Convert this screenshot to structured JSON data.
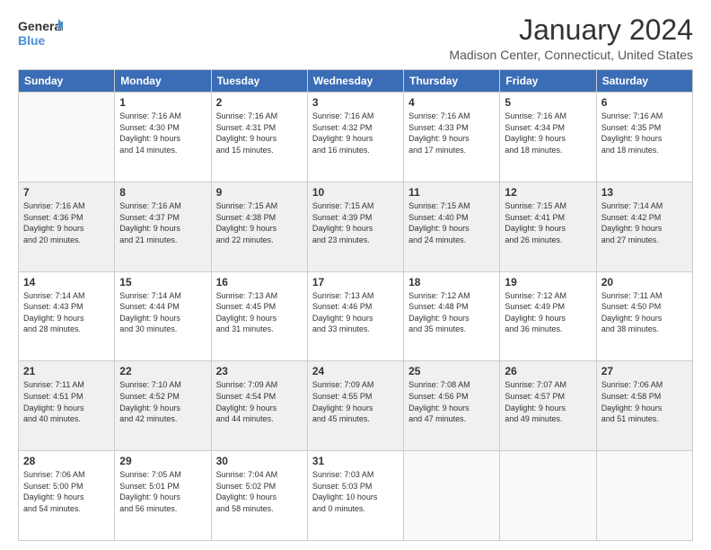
{
  "header": {
    "logo_line1": "General",
    "logo_line2": "Blue",
    "title": "January 2024",
    "subtitle": "Madison Center, Connecticut, United States"
  },
  "weekdays": [
    "Sunday",
    "Monday",
    "Tuesday",
    "Wednesday",
    "Thursday",
    "Friday",
    "Saturday"
  ],
  "weeks": [
    [
      {
        "day": "",
        "info": ""
      },
      {
        "day": "1",
        "info": "Sunrise: 7:16 AM\nSunset: 4:30 PM\nDaylight: 9 hours\nand 14 minutes."
      },
      {
        "day": "2",
        "info": "Sunrise: 7:16 AM\nSunset: 4:31 PM\nDaylight: 9 hours\nand 15 minutes."
      },
      {
        "day": "3",
        "info": "Sunrise: 7:16 AM\nSunset: 4:32 PM\nDaylight: 9 hours\nand 16 minutes."
      },
      {
        "day": "4",
        "info": "Sunrise: 7:16 AM\nSunset: 4:33 PM\nDaylight: 9 hours\nand 17 minutes."
      },
      {
        "day": "5",
        "info": "Sunrise: 7:16 AM\nSunset: 4:34 PM\nDaylight: 9 hours\nand 18 minutes."
      },
      {
        "day": "6",
        "info": "Sunrise: 7:16 AM\nSunset: 4:35 PM\nDaylight: 9 hours\nand 18 minutes."
      }
    ],
    [
      {
        "day": "7",
        "info": "Sunrise: 7:16 AM\nSunset: 4:36 PM\nDaylight: 9 hours\nand 20 minutes."
      },
      {
        "day": "8",
        "info": "Sunrise: 7:16 AM\nSunset: 4:37 PM\nDaylight: 9 hours\nand 21 minutes."
      },
      {
        "day": "9",
        "info": "Sunrise: 7:15 AM\nSunset: 4:38 PM\nDaylight: 9 hours\nand 22 minutes."
      },
      {
        "day": "10",
        "info": "Sunrise: 7:15 AM\nSunset: 4:39 PM\nDaylight: 9 hours\nand 23 minutes."
      },
      {
        "day": "11",
        "info": "Sunrise: 7:15 AM\nSunset: 4:40 PM\nDaylight: 9 hours\nand 24 minutes."
      },
      {
        "day": "12",
        "info": "Sunrise: 7:15 AM\nSunset: 4:41 PM\nDaylight: 9 hours\nand 26 minutes."
      },
      {
        "day": "13",
        "info": "Sunrise: 7:14 AM\nSunset: 4:42 PM\nDaylight: 9 hours\nand 27 minutes."
      }
    ],
    [
      {
        "day": "14",
        "info": "Sunrise: 7:14 AM\nSunset: 4:43 PM\nDaylight: 9 hours\nand 28 minutes."
      },
      {
        "day": "15",
        "info": "Sunrise: 7:14 AM\nSunset: 4:44 PM\nDaylight: 9 hours\nand 30 minutes."
      },
      {
        "day": "16",
        "info": "Sunrise: 7:13 AM\nSunset: 4:45 PM\nDaylight: 9 hours\nand 31 minutes."
      },
      {
        "day": "17",
        "info": "Sunrise: 7:13 AM\nSunset: 4:46 PM\nDaylight: 9 hours\nand 33 minutes."
      },
      {
        "day": "18",
        "info": "Sunrise: 7:12 AM\nSunset: 4:48 PM\nDaylight: 9 hours\nand 35 minutes."
      },
      {
        "day": "19",
        "info": "Sunrise: 7:12 AM\nSunset: 4:49 PM\nDaylight: 9 hours\nand 36 minutes."
      },
      {
        "day": "20",
        "info": "Sunrise: 7:11 AM\nSunset: 4:50 PM\nDaylight: 9 hours\nand 38 minutes."
      }
    ],
    [
      {
        "day": "21",
        "info": "Sunrise: 7:11 AM\nSunset: 4:51 PM\nDaylight: 9 hours\nand 40 minutes."
      },
      {
        "day": "22",
        "info": "Sunrise: 7:10 AM\nSunset: 4:52 PM\nDaylight: 9 hours\nand 42 minutes."
      },
      {
        "day": "23",
        "info": "Sunrise: 7:09 AM\nSunset: 4:54 PM\nDaylight: 9 hours\nand 44 minutes."
      },
      {
        "day": "24",
        "info": "Sunrise: 7:09 AM\nSunset: 4:55 PM\nDaylight: 9 hours\nand 45 minutes."
      },
      {
        "day": "25",
        "info": "Sunrise: 7:08 AM\nSunset: 4:56 PM\nDaylight: 9 hours\nand 47 minutes."
      },
      {
        "day": "26",
        "info": "Sunrise: 7:07 AM\nSunset: 4:57 PM\nDaylight: 9 hours\nand 49 minutes."
      },
      {
        "day": "27",
        "info": "Sunrise: 7:06 AM\nSunset: 4:58 PM\nDaylight: 9 hours\nand 51 minutes."
      }
    ],
    [
      {
        "day": "28",
        "info": "Sunrise: 7:06 AM\nSunset: 5:00 PM\nDaylight: 9 hours\nand 54 minutes."
      },
      {
        "day": "29",
        "info": "Sunrise: 7:05 AM\nSunset: 5:01 PM\nDaylight: 9 hours\nand 56 minutes."
      },
      {
        "day": "30",
        "info": "Sunrise: 7:04 AM\nSunset: 5:02 PM\nDaylight: 9 hours\nand 58 minutes."
      },
      {
        "day": "31",
        "info": "Sunrise: 7:03 AM\nSunset: 5:03 PM\nDaylight: 10 hours\nand 0 minutes."
      },
      {
        "day": "",
        "info": ""
      },
      {
        "day": "",
        "info": ""
      },
      {
        "day": "",
        "info": ""
      }
    ]
  ]
}
